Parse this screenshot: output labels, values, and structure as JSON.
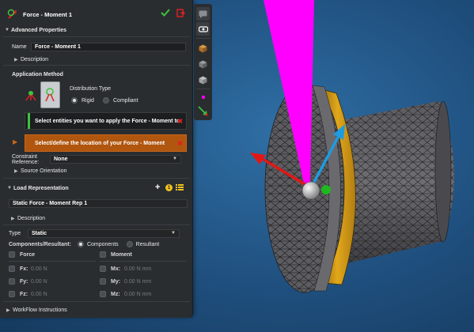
{
  "dialog": {
    "title": "Force - Moment 1",
    "advanced_properties": "Advanced Properties",
    "name_label": "Name",
    "name_value": "Force - Moment 1",
    "description_label": "Description",
    "application_method": "Application Method",
    "distribution_type": "Distribution Type",
    "rigid": "Rigid",
    "compliant": "Compliant",
    "select_entities": "Select entities you want to apply the Force - Moment to",
    "select_location": "Select/define the location of your Force - Moment",
    "constraint_reference_label": "Constraint Reference:",
    "constraint_reference_value": "None",
    "source_orientation": "Source Orientation",
    "load_representation": "Load Representation",
    "rep_name": "Static Force - Moment Rep 1",
    "rep_description": "Description",
    "type_label": "Type",
    "type_value": "Static",
    "comp_resultant_label": "Components/Resultant:",
    "components": "Components",
    "resultant": "Resultant",
    "force": "Force",
    "moment": "Moment",
    "fx": "Fx:",
    "fy": "Fy:",
    "fz": "Fz:",
    "mx": "Mx:",
    "my": "My:",
    "mz": "Mz:",
    "fx_val": "0.00 N",
    "fy_val": "0.00 N",
    "fz_val": "0.00 N",
    "mx_val": "0.00 N mm",
    "my_val": "0.00 N mm",
    "mz_val": "0.00 N mm",
    "workflow": "WorkFlow Instructions",
    "badge_count": "1"
  },
  "colors": {
    "accent_green": "#3ec23e",
    "accent_orange": "#b0560f",
    "cancel_red": "#e02020",
    "viewport_bg": "#1f4f7e",
    "force_beam": "#ff00ff",
    "ring": "#e0a418",
    "arrow_red": "#e01818",
    "arrow_blue": "#1e9be0",
    "arrow_green": "#1fb81f"
  }
}
